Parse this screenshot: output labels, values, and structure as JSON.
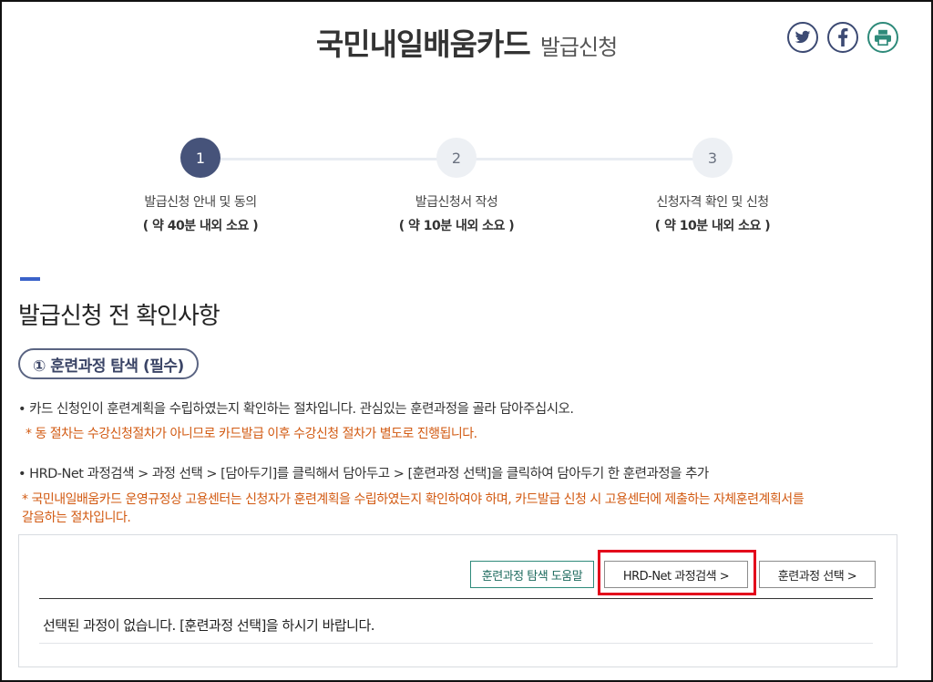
{
  "header": {
    "title": "국민내일배움카드",
    "subtitle": "발급신청",
    "share_icons": [
      {
        "name": "twitter-icon",
        "color": "#3c4a73"
      },
      {
        "name": "facebook-icon",
        "color": "#3c4a73"
      },
      {
        "name": "print-icon",
        "color": "#2e8a7a"
      }
    ]
  },
  "steps": [
    {
      "number": "1",
      "label": "발급신청 안내 및 동의",
      "time": "( 약 40분 내외 소요 )",
      "active": true
    },
    {
      "number": "2",
      "label": "발급신청서 작성",
      "time": "( 약 10분 내외 소요 )",
      "active": false
    },
    {
      "number": "3",
      "label": "신청자격 확인 및 신청",
      "time": "( 약 10분 내외 소요 )",
      "active": false
    }
  ],
  "section": {
    "title": "발급신청 전 확인사항",
    "pill": "① 훈련과정 탐색 (필수)",
    "bullet1": "• 카드 신청인이 훈련계획을 수립하였는지 확인하는 절차입니다. 관심있는 훈련과정을 골라 담아주십시오.",
    "note1": "* 동 절차는 수강신청절차가 아니므로 카드발급 이후 수강신청 절차가 별도로 진행됩니다.",
    "bullet2": "• HRD-Net 과정검색 > 과정 선택 > [담아두기]를 클릭해서 담아두고 > [훈련과정 선택]을 클릭하여 담아두기 한 훈련과정을 추가",
    "note2_line1": "* 국민내일배움카드 운영규정상 고용센터는 신청자가 훈련계획을 수립하였는지 확인하여야 하며, 카드발급 신청 시 고용센터에 제출하는 자체훈련계획서를",
    "note2_line2": "갈음하는 절차입니다."
  },
  "course_box": {
    "help_button": "훈련과정 탐색 도움말",
    "search_button": "HRD-Net 과정검색 >",
    "select_button": "훈련과정 선택 >",
    "empty_message": "선택된 과정이 없습니다. [훈련과정 선택]을 하시기 바랍니다."
  },
  "colors": {
    "accent": "#46537a",
    "warning": "#d25a12",
    "highlight": "#e3001b",
    "teal": "#2e8a7a"
  }
}
